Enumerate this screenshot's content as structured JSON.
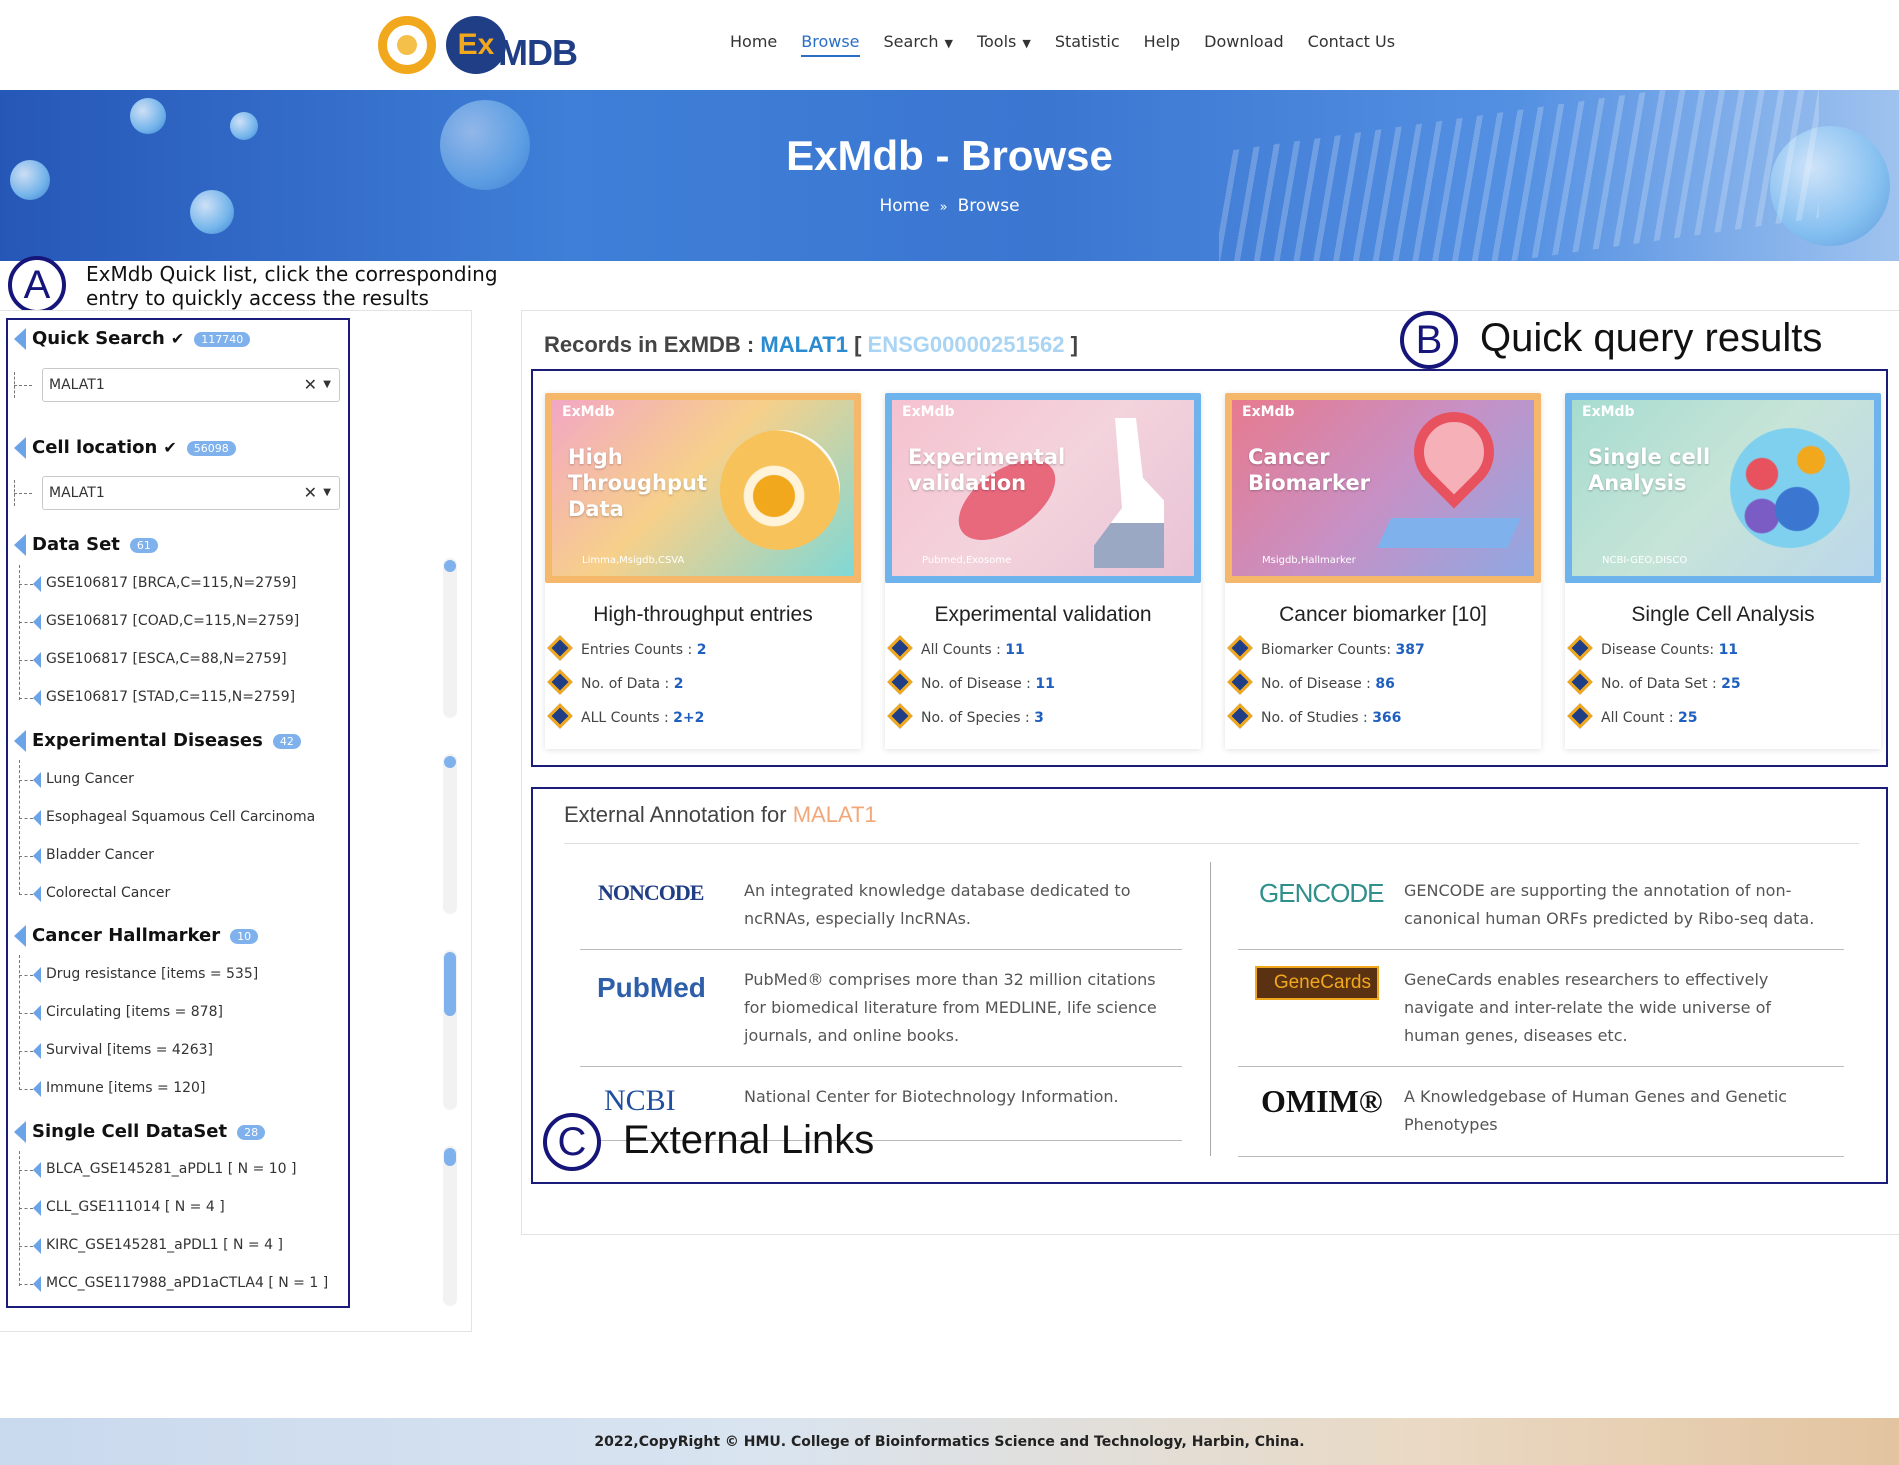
{
  "header": {
    "logo_ex": "Ex",
    "logo_mdb": "MDB",
    "nav": [
      {
        "label": "Home"
      },
      {
        "label": "Browse"
      },
      {
        "label": "Search"
      },
      {
        "label": "Tools"
      },
      {
        "label": "Statistic"
      },
      {
        "label": "Help"
      },
      {
        "label": "Download"
      },
      {
        "label": "Contact Us"
      }
    ],
    "active": "Browse"
  },
  "banner": {
    "title": "ExMdb - Browse",
    "crumb_home": "Home",
    "crumb_current": "Browse"
  },
  "annotations": {
    "a_letter": "A",
    "a_text": "ExMdb Quick list, click the corresponding entry to quickly access the results",
    "b_letter": "B",
    "b_text": "Quick query results",
    "c_letter": "C",
    "c_text": "External Links"
  },
  "sidebar": {
    "quick_search": {
      "label": "Quick Search",
      "count": "117740",
      "value": "MALAT1"
    },
    "cell_location": {
      "label": "Cell location",
      "count": "56098",
      "value": "MALAT1"
    },
    "data_set": {
      "label": "Data Set",
      "count": "61",
      "items": [
        "GSE106817 [BRCA,C=115,N=2759]",
        "GSE106817 [COAD,C=115,N=2759]",
        "GSE106817 [ESCA,C=88,N=2759]",
        "GSE106817 [STAD,C=115,N=2759]"
      ]
    },
    "experimental_diseases": {
      "label": "Experimental Diseases",
      "count": "42",
      "items": [
        "Lung Cancer",
        "Esophageal Squamous Cell Carcinoma",
        "Bladder Cancer",
        "Colorectal Cancer"
      ]
    },
    "cancer_hallmarker": {
      "label": "Cancer Hallmarker",
      "count": "10",
      "items": [
        "Drug resistance [items = 535]",
        "Circulating [items = 878]",
        "Survival [items = 4263]",
        "Immune [items = 120]"
      ]
    },
    "single_cell": {
      "label": "Single Cell DataSet",
      "count": "28",
      "items": [
        "BLCA_GSE145281_aPDL1 [ N = 10 ]",
        "CLL_GSE111014 [ N = 4 ]",
        "KIRC_GSE145281_aPDL1 [ N = 4 ]",
        "MCC_GSE117988_aPD1aCTLA4 [ N = 1 ]"
      ]
    }
  },
  "records": {
    "prefix": "Records in ExMDB : ",
    "gene": "MALAT1",
    "ensg": "ENSG00000251562"
  },
  "cards": [
    {
      "tag": "ExMdb",
      "image_text": "High Throughput Data",
      "image_sub": "Limma,Msigdb,CSVA",
      "title": "High-throughput entries",
      "stats": [
        {
          "label": "Entries Counts : ",
          "value": "2"
        },
        {
          "label": "No. of Data : ",
          "value": "2"
        },
        {
          "label": "ALL Counts : ",
          "value": "2+2"
        }
      ],
      "color": "#f5b86a"
    },
    {
      "tag": "ExMdb",
      "image_text": "Experimental validation",
      "image_sub": "Pubmed,Exosome",
      "title": "Experimental validation",
      "stats": [
        {
          "label": "All Counts : ",
          "value": "11"
        },
        {
          "label": "No. of Disease : ",
          "value": "11"
        },
        {
          "label": "No. of Species : ",
          "value": "3"
        }
      ],
      "color": "#6fb3ec"
    },
    {
      "tag": "ExMdb",
      "image_text": "Cancer Biomarker",
      "image_sub": "Msigdb,Hallmarker",
      "title": "Cancer biomarker [10]",
      "stats": [
        {
          "label": "Biomarker Counts: ",
          "value": "387"
        },
        {
          "label": "No. of Disease : ",
          "value": "86"
        },
        {
          "label": "No. of Studies : ",
          "value": "366"
        }
      ],
      "color": "#f5b86a"
    },
    {
      "tag": "ExMdb",
      "image_text": "Single cell Analysis",
      "image_sub": "NCBI-GEO,DISCO",
      "title": "Single Cell Analysis",
      "stats": [
        {
          "label": "Disease Counts: ",
          "value": "11"
        },
        {
          "label": "No. of Data Set : ",
          "value": "25"
        },
        {
          "label": "All Count : ",
          "value": "25"
        }
      ],
      "color": "#6fb3ec"
    }
  ],
  "external": {
    "title_prefix": "External Annotation for ",
    "gene": "MALAT1",
    "left": [
      {
        "logo": "NONCODE",
        "desc": "An integrated knowledge database dedicated to ncRNAs, especially lncRNAs."
      },
      {
        "logo": "PubMed",
        "desc": "PubMed® comprises more than 32 million citations for biomedical literature from MEDLINE, life science journals, and online books."
      },
      {
        "logo": "NCBI",
        "desc": "National Center for Biotechnology Information."
      }
    ],
    "right": [
      {
        "logo": "GENCODE",
        "desc": "GENCODE are supporting the annotation of non-canonical human ORFs predicted by Ribo-seq data."
      },
      {
        "logo": "GeneCards",
        "desc": "GeneCards enables researchers to effectively navigate and inter-relate the wide universe of human genes, diseases etc."
      },
      {
        "logo": "OMIM®",
        "desc": "A Knowledgebase of Human Genes and Genetic Phenotypes"
      }
    ]
  },
  "footer": {
    "text": "2022,CopyRight © HMU. College of Bioinformatics Science and Technology, Harbin, China."
  }
}
